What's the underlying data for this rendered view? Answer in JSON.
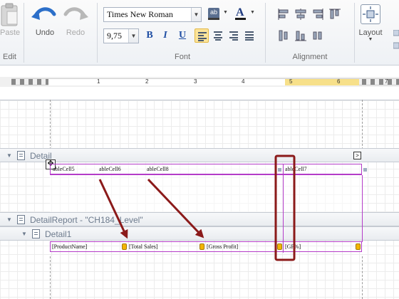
{
  "ribbon": {
    "edit": {
      "paste_label": "Paste",
      "undo_label": "Undo",
      "redo_label": "Redo",
      "group_label": "Edit"
    },
    "font": {
      "font_name": "Times New Roman",
      "font_size": "9,75",
      "bold_label": "B",
      "italic_label": "I",
      "underline_label": "U",
      "group_label": "Font"
    },
    "alignment": {
      "group_label": "Alignment"
    },
    "layout": {
      "label": "Layout"
    }
  },
  "ruler": {
    "numbers": [
      "1",
      "2",
      "3",
      "4",
      "5",
      "6",
      "7"
    ]
  },
  "bands": {
    "detail": {
      "label": "Detail",
      "cells": [
        "ableCell5",
        "ableCell6",
        "ableCell8",
        "ableCell7"
      ]
    },
    "detail_report": {
      "label": "DetailReport - \"CH184_Level\""
    },
    "detail1": {
      "label": "Detail1",
      "cells": [
        "[ProductName]",
        "[Total Sales]",
        "[Gross Profit]",
        "[GP%]"
      ]
    }
  },
  "colors": {
    "annotation": "#8b1a1a",
    "selection": "#b43cc8",
    "active_button": "#fbe49a"
  }
}
